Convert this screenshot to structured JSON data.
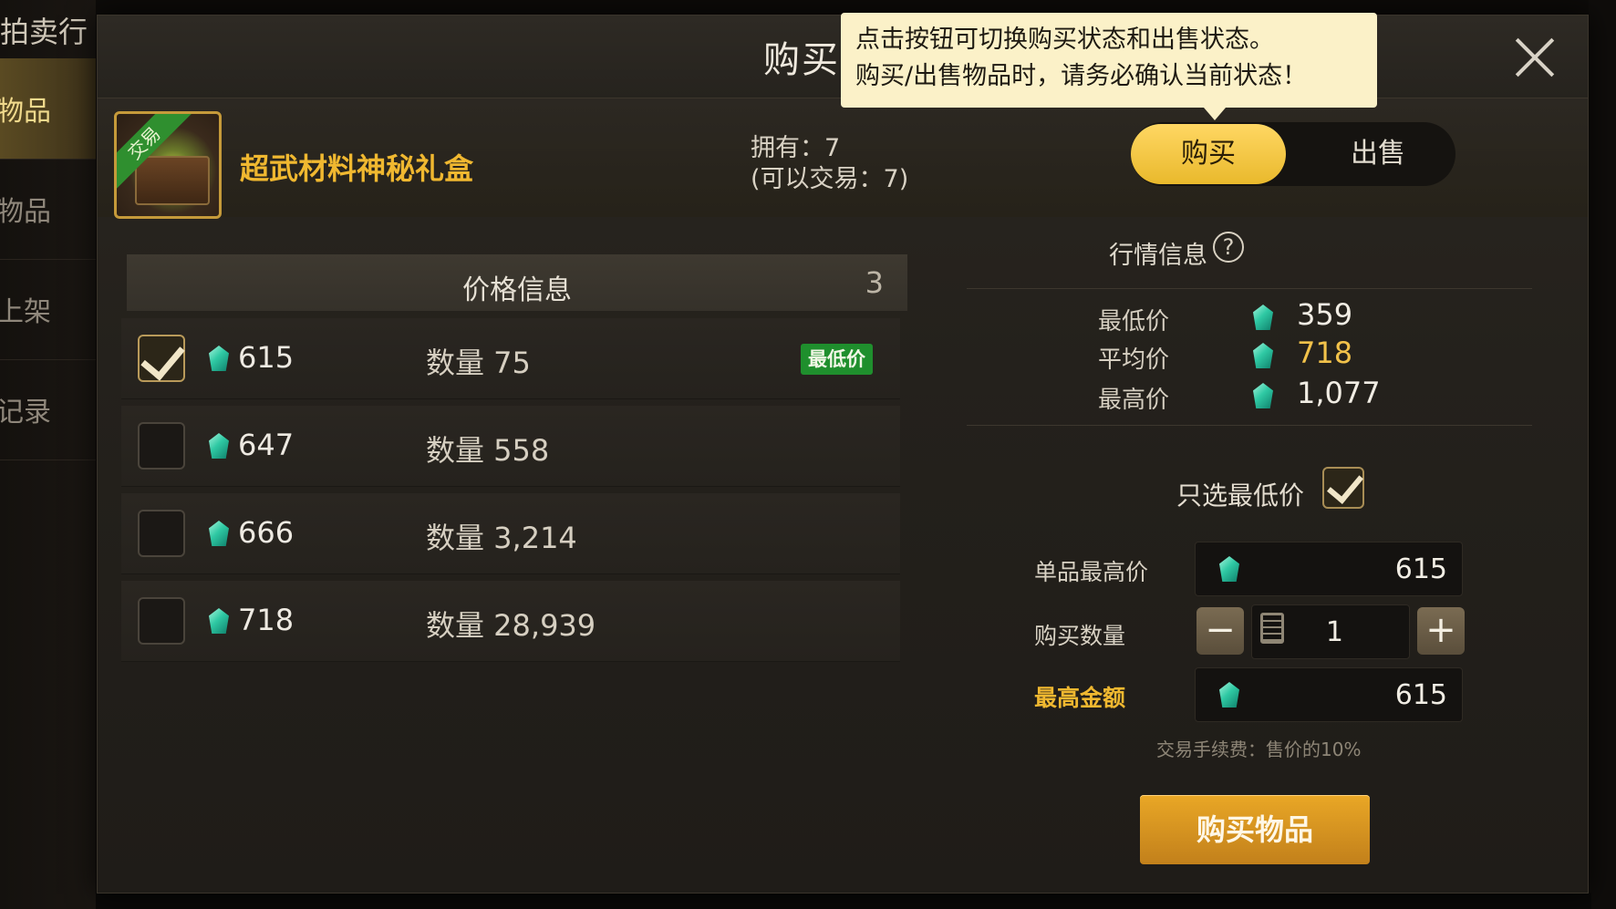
{
  "background": {
    "app_title": "拍卖行",
    "side_items": [
      "物品",
      "物品",
      "上架",
      "记录"
    ]
  },
  "dialog": {
    "title": "购买物品",
    "close_icon": "close-icon"
  },
  "tooltip": {
    "line1": "点击按钮可切换购买状态和出售状态。",
    "line2": "购买/出售物品时，请务必确认当前状态！"
  },
  "item": {
    "name": "超武材料神秘礼盒",
    "tag": "交易",
    "owned_line": "拥有：7",
    "tradable_line": "(可以交易：7)"
  },
  "mode": {
    "buy": "购买",
    "sell": "出售",
    "selected": "buy"
  },
  "price_info": {
    "title": "价格信息",
    "count": "3",
    "rows": [
      {
        "price": "615",
        "qty": "数量 75",
        "checked": true,
        "badge": "最低价"
      },
      {
        "price": "647",
        "qty": "数量 558",
        "checked": false,
        "badge": ""
      },
      {
        "price": "666",
        "qty": "数量 3,214",
        "checked": false,
        "badge": ""
      },
      {
        "price": "718",
        "qty": "数量 28,939",
        "checked": false,
        "badge": ""
      }
    ]
  },
  "market": {
    "title": "行情信息",
    "help_icon": "?",
    "min_label": "最低价",
    "min_value": "359",
    "avg_label": "平均价",
    "avg_value": "718",
    "max_label": "最高价",
    "max_value": "1,077"
  },
  "purchase": {
    "only_lowest_label": "只选最低价",
    "only_lowest_checked": true,
    "unit_max_label": "单品最高价",
    "unit_max_value": "615",
    "qty_label": "购买数量",
    "qty_value": "1",
    "minus": "−",
    "plus": "+",
    "total_label": "最高金额",
    "total_value": "615",
    "fee_note": "交易手续费：售价的10%",
    "buy_button": "购买物品"
  },
  "colors": {
    "accent_gold": "#f0b830",
    "gem": "#2fc9a4",
    "badge_green": "#1f8f2d"
  }
}
